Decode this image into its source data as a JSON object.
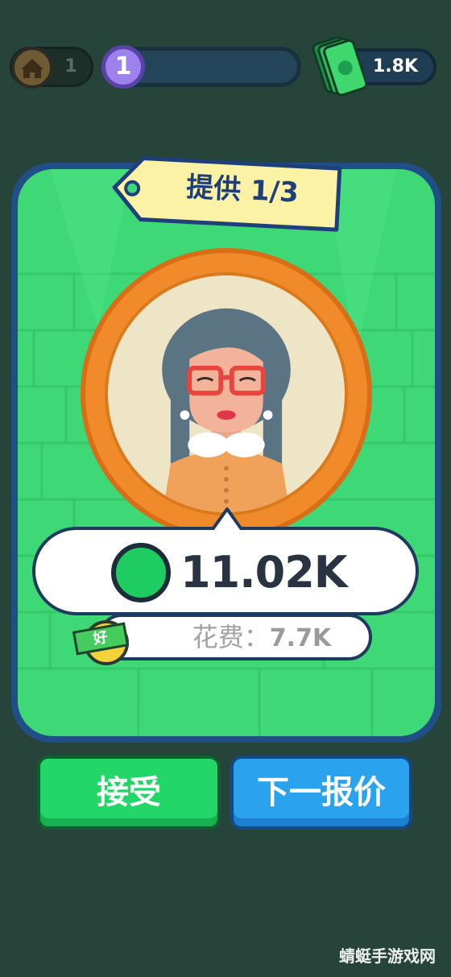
{
  "hud": {
    "home_icon": "home-icon",
    "home_count": "1",
    "level": "1",
    "xp_progress": 0,
    "cash_icon": "cash-stack-icon",
    "cash": "1.8K"
  },
  "offer": {
    "tag_label": "提供 1/3",
    "value": "11.02K",
    "coin_icon": "coin-icon",
    "cost_label": "花费：",
    "cost_value": "7.7K",
    "rating_label": "好"
  },
  "buttons": {
    "accept": "接受",
    "next_offer": "下一报价"
  },
  "watermark": "蜻蜓手游戏网",
  "colors": {
    "background": "#27443a",
    "card": "#3ed876",
    "card_border": "#1f4f86",
    "ring": "#f18a2b",
    "accept": "#23d668",
    "next": "#2aa2ee"
  }
}
